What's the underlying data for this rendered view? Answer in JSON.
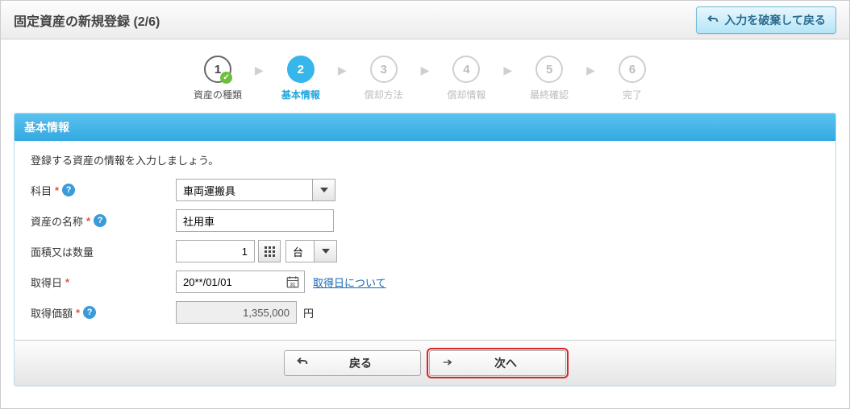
{
  "page": {
    "title": "固定資産の新規登録 (2/6)",
    "discard_label": "入力を破棄して戻る"
  },
  "steps": {
    "items": [
      {
        "num": "1",
        "label": "資産の種類",
        "state": "done"
      },
      {
        "num": "2",
        "label": "基本情報",
        "state": "active"
      },
      {
        "num": "3",
        "label": "償却方法",
        "state": "pending"
      },
      {
        "num": "4",
        "label": "償却情報",
        "state": "pending"
      },
      {
        "num": "5",
        "label": "最終確認",
        "state": "pending"
      },
      {
        "num": "6",
        "label": "完了",
        "state": "pending"
      }
    ]
  },
  "panel": {
    "header": "基本情報",
    "intro": "登録する資産の情報を入力しましょう。"
  },
  "form": {
    "category": {
      "label": "科目",
      "required": true,
      "help": true,
      "value": "車両運搬具"
    },
    "name": {
      "label": "資産の名称",
      "required": true,
      "help": true,
      "value": "社用車"
    },
    "quantity": {
      "label": "面積又は数量",
      "required": false,
      "help": false,
      "value": "1",
      "unit": "台"
    },
    "date": {
      "label": "取得日",
      "required": true,
      "help": false,
      "value": "20**/01/01",
      "link": "取得日について"
    },
    "price": {
      "label": "取得価額",
      "required": true,
      "help": true,
      "value": "1,355,000",
      "unit": "円"
    }
  },
  "footer": {
    "back": "戻る",
    "next": "次へ"
  }
}
